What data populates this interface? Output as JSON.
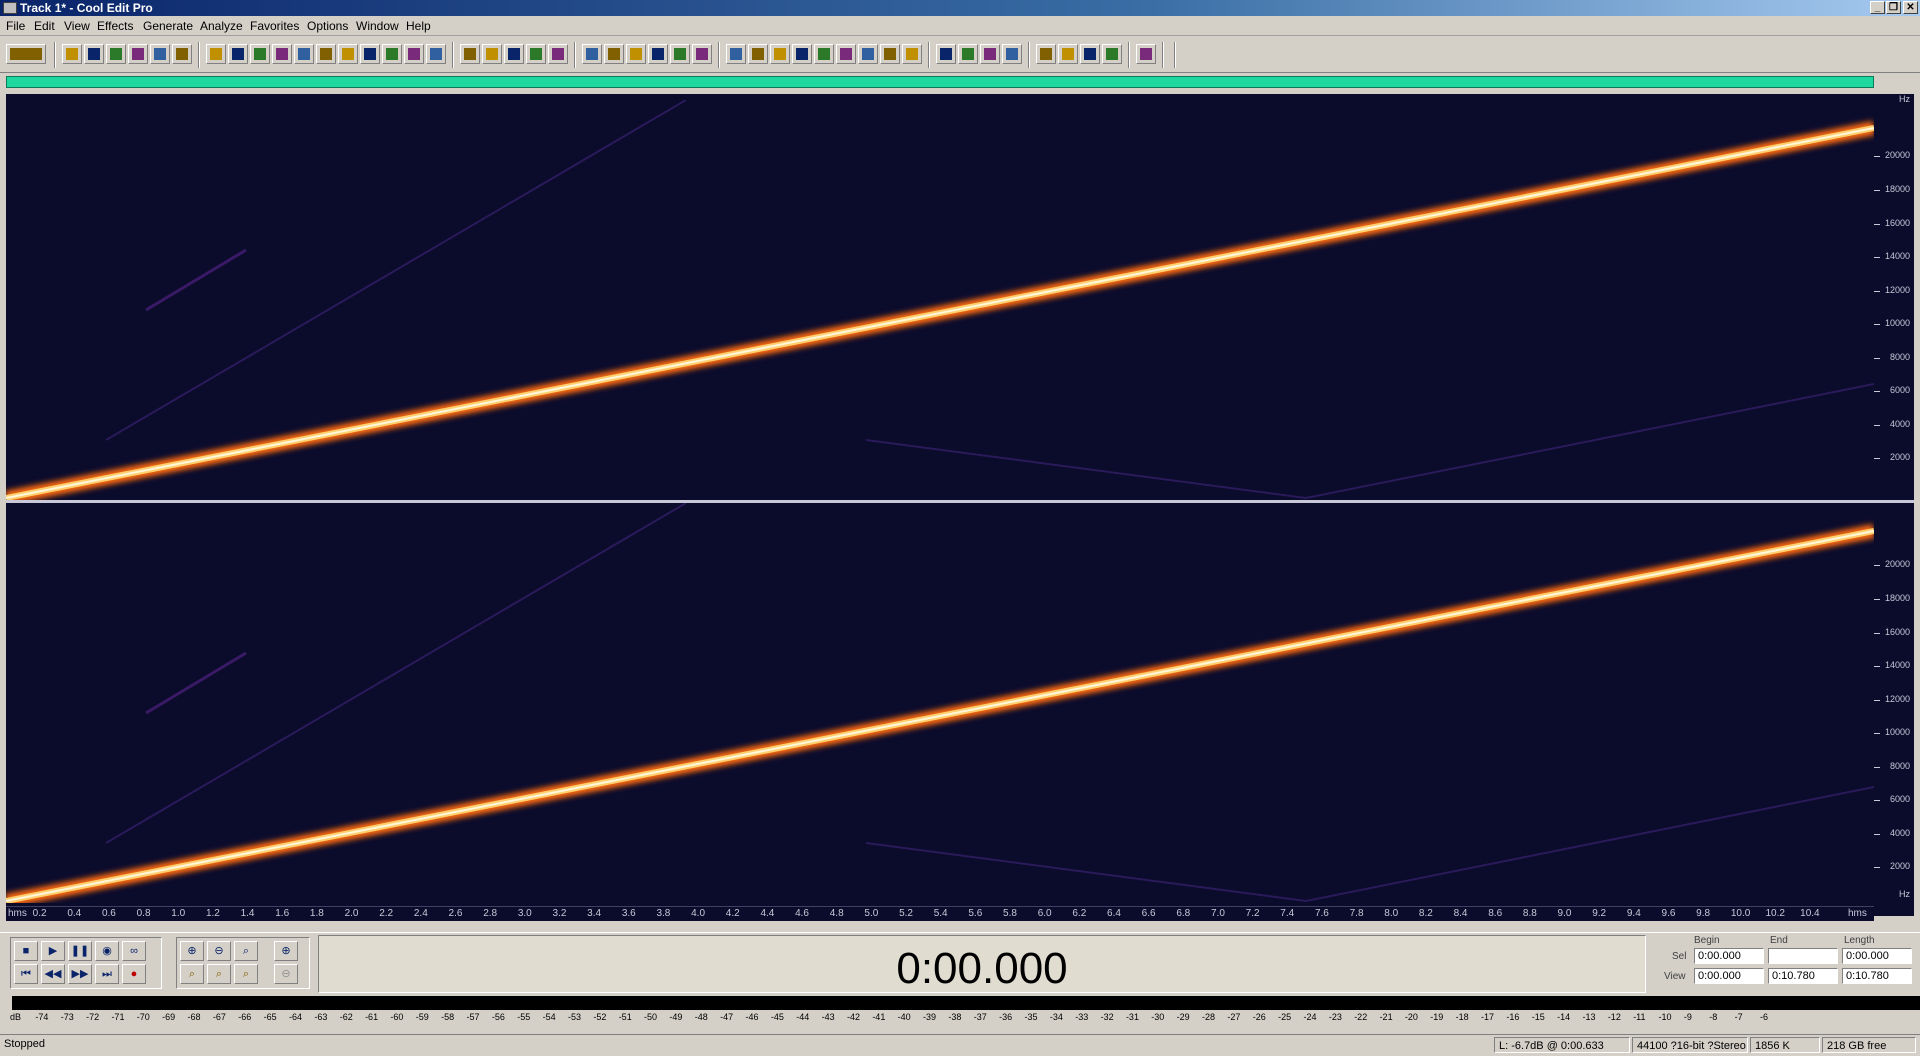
{
  "window": {
    "title": "Track 1* - Cool Edit Pro",
    "controls": [
      "_",
      "❐",
      "✕"
    ]
  },
  "menu": [
    "File",
    "Edit",
    "View",
    "Effects",
    "Generate",
    "Analyze",
    "Favorites",
    "Options",
    "Window",
    "Help"
  ],
  "freq_axis": {
    "unit": "Hz",
    "ticks": [
      "20000",
      "18000",
      "16000",
      "14000",
      "12000",
      "10000",
      "8000",
      "6000",
      "4000",
      "2000"
    ]
  },
  "time_axis": {
    "unit_start": "hms",
    "unit_end": "hms",
    "ticks": [
      "0.2",
      "0.4",
      "0.6",
      "0.8",
      "1.0",
      "1.2",
      "1.4",
      "1.6",
      "1.8",
      "2.0",
      "2.2",
      "2.4",
      "2.6",
      "2.8",
      "3.0",
      "3.2",
      "3.4",
      "3.6",
      "3.8",
      "4.0",
      "4.2",
      "4.4",
      "4.6",
      "4.8",
      "5.0",
      "5.2",
      "5.4",
      "5.6",
      "5.8",
      "6.0",
      "6.2",
      "6.4",
      "6.6",
      "6.8",
      "7.0",
      "7.2",
      "7.4",
      "7.6",
      "7.8",
      "8.0",
      "8.2",
      "8.4",
      "8.6",
      "8.8",
      "9.0",
      "9.2",
      "9.4",
      "9.6",
      "9.8",
      "10.0",
      "10.2",
      "10.4"
    ]
  },
  "transport": {
    "time": "0:00.000",
    "labels": {
      "begin": "Begin",
      "end": "End",
      "length": "Length",
      "sel": "Sel",
      "view": "View"
    },
    "sel": {
      "begin": "0:00.000",
      "end": "",
      "length": "0:00.000"
    },
    "view": {
      "begin": "0:00.000",
      "end": "0:10.780",
      "length": "0:10.780"
    }
  },
  "meter": {
    "labels": [
      "dB",
      "-74",
      "-73",
      "-72",
      "-71",
      "-70",
      "-69",
      "-68",
      "-67",
      "-66",
      "-65",
      "-64",
      "-63",
      "-62",
      "-61",
      "-60",
      "-59",
      "-58",
      "-57",
      "-56",
      "-55",
      "-54",
      "-53",
      "-52",
      "-51",
      "-50",
      "-49",
      "-48",
      "-47",
      "-46",
      "-45",
      "-44",
      "-43",
      "-42",
      "-41",
      "-40",
      "-39",
      "-38",
      "-37",
      "-36",
      "-35",
      "-34",
      "-33",
      "-32",
      "-31",
      "-30",
      "-29",
      "-28",
      "-27",
      "-26",
      "-25",
      "-24",
      "-23",
      "-22",
      "-21",
      "-20",
      "-19",
      "-18",
      "-17",
      "-16",
      "-15",
      "-14",
      "-13",
      "-12",
      "-11",
      "-10",
      "-9",
      "-8",
      "-7",
      "-6"
    ]
  },
  "status": {
    "state": "Stopped",
    "cursor": "L: -6.7dB @  0:00.633",
    "format": "44100 ?16-bit ?Stereo",
    "size": "1856 K",
    "free": "218 GB free"
  },
  "colors": {
    "spectral_bg": "#0b0b2c",
    "sweep_core": "#fff2c0",
    "sweep_glow": "#ff7a1a",
    "overview": "#1fd8a0",
    "titlebar": "#0a246a"
  },
  "toolbar_icons": [
    "mode-switch-icon",
    "new-file-icon",
    "open-file-icon",
    "save-icon",
    "save-as-icon",
    "close-file-icon",
    "undo-icon",
    "redo-icon",
    "repeat-last-icon",
    "copy-icon",
    "copy-new-icon",
    "cut-icon",
    "paste-icon",
    "paste-new-icon",
    "mix-paste-icon",
    "trim-icon",
    "properties-icon",
    "waveform-view-icon",
    "spectral-view-icon",
    "spectral-pitch-icon",
    "snap-icon",
    "overlay-icon",
    "zoom-full-icon",
    "select-all-icon",
    "play-selection-icon",
    "zoom-selection-icon",
    "set-markers-icon",
    "show-grid-icon",
    "markers-icon",
    "help-icon",
    "cue-list-icon",
    "scan-icon",
    "analyze-icon",
    "amplify-icon",
    "delay-icon",
    "filter-icon",
    "noise-reduction-icon",
    "envelope-icon",
    "reverse-icon",
    "silence-icon",
    "pitch-bend-icon",
    "stretch-icon",
    "eq-icon",
    "dynamics-icon",
    "mixer-icon",
    "fade-icon",
    "settings-icon"
  ]
}
